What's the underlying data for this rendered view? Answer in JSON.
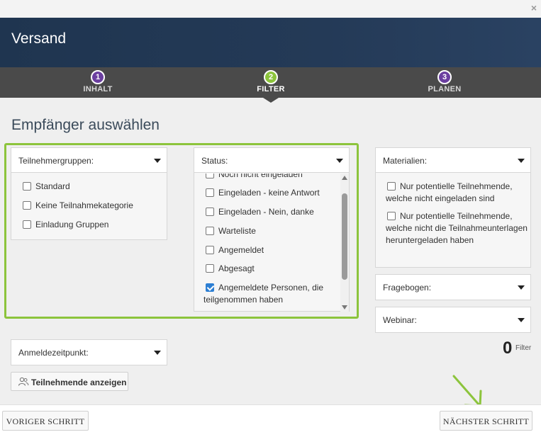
{
  "dialog": {
    "close_glyph": "×"
  },
  "header": {
    "title": "Versand"
  },
  "steps": [
    {
      "num": "1",
      "label": "INHALT",
      "color": "#6b3fa0"
    },
    {
      "num": "2",
      "label": "FILTER",
      "color": "#8cc43c",
      "active": true
    },
    {
      "num": "3",
      "label": "PLANEN",
      "color": "#6b3fa0"
    }
  ],
  "section": {
    "title": "Empfänger auswählen"
  },
  "groups": {
    "label": "Teilnehmergruppen:",
    "options": [
      {
        "label": "Standard",
        "checked": false
      },
      {
        "label": "Keine Teilnahmekategorie",
        "checked": false
      },
      {
        "label": "Einladung Gruppen",
        "checked": false
      }
    ]
  },
  "status": {
    "label": "Status:",
    "options": [
      {
        "label": "Noch nicht eingeladen",
        "checked": false
      },
      {
        "label": "Eingeladen - keine Antwort",
        "checked": false
      },
      {
        "label": "Eingeladen - Nein, danke",
        "checked": false
      },
      {
        "label": "Warteliste",
        "checked": false
      },
      {
        "label": "Angemeldet",
        "checked": false
      },
      {
        "label": "Abgesagt",
        "checked": false
      },
      {
        "label": "Angemeldete Personen, die",
        "label2": "teilgenommen haben",
        "checked": true
      }
    ]
  },
  "materials": {
    "label": "Materialien:",
    "options": [
      {
        "label": "Nur potentielle Teilnehmende, welche nicht eingeladen sind",
        "checked": false
      },
      {
        "label": "Nur potentielle Teilnehmende, welche nicht die Teilnahmeunterlagen heruntergeladen haben",
        "checked": false
      }
    ]
  },
  "questionnaire": {
    "label": "Fragebogen:"
  },
  "webinar": {
    "label": "Webinar:"
  },
  "registration_time": {
    "label": "Anmeldezeitpunkt:"
  },
  "filter_summary": {
    "count": "0",
    "label": "Filter"
  },
  "buttons": {
    "show_participants": "Teilnehmende anzeigen",
    "prev": "VORIGER SCHRITT",
    "next": "NÄCHSTER SCHRITT"
  },
  "colors": {
    "accent_green": "#8cc43c",
    "step_purple": "#6b3fa0",
    "header_navy": "#1f3550"
  },
  "icons": {
    "close": "close-icon",
    "user": "users-icon",
    "arrow": "arrow-down-right-icon"
  }
}
